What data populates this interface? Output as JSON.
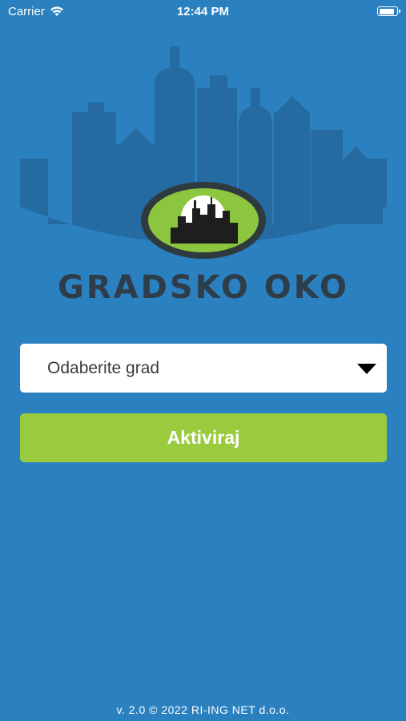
{
  "status_bar": {
    "carrier": "Carrier",
    "time": "12:44 PM",
    "battery_level": 0.9
  },
  "logo": {
    "title": "GRADSKO OKO",
    "eye_color": "#8cc63f",
    "skyline_color": "#256aa0"
  },
  "form": {
    "city_select_placeholder": "Odaberite grad",
    "activate_label": "Aktiviraj",
    "accent": "#9acb3f"
  },
  "footer": {
    "text": "v. 2.0 © 2022 RI-ING NET d.o.o."
  }
}
